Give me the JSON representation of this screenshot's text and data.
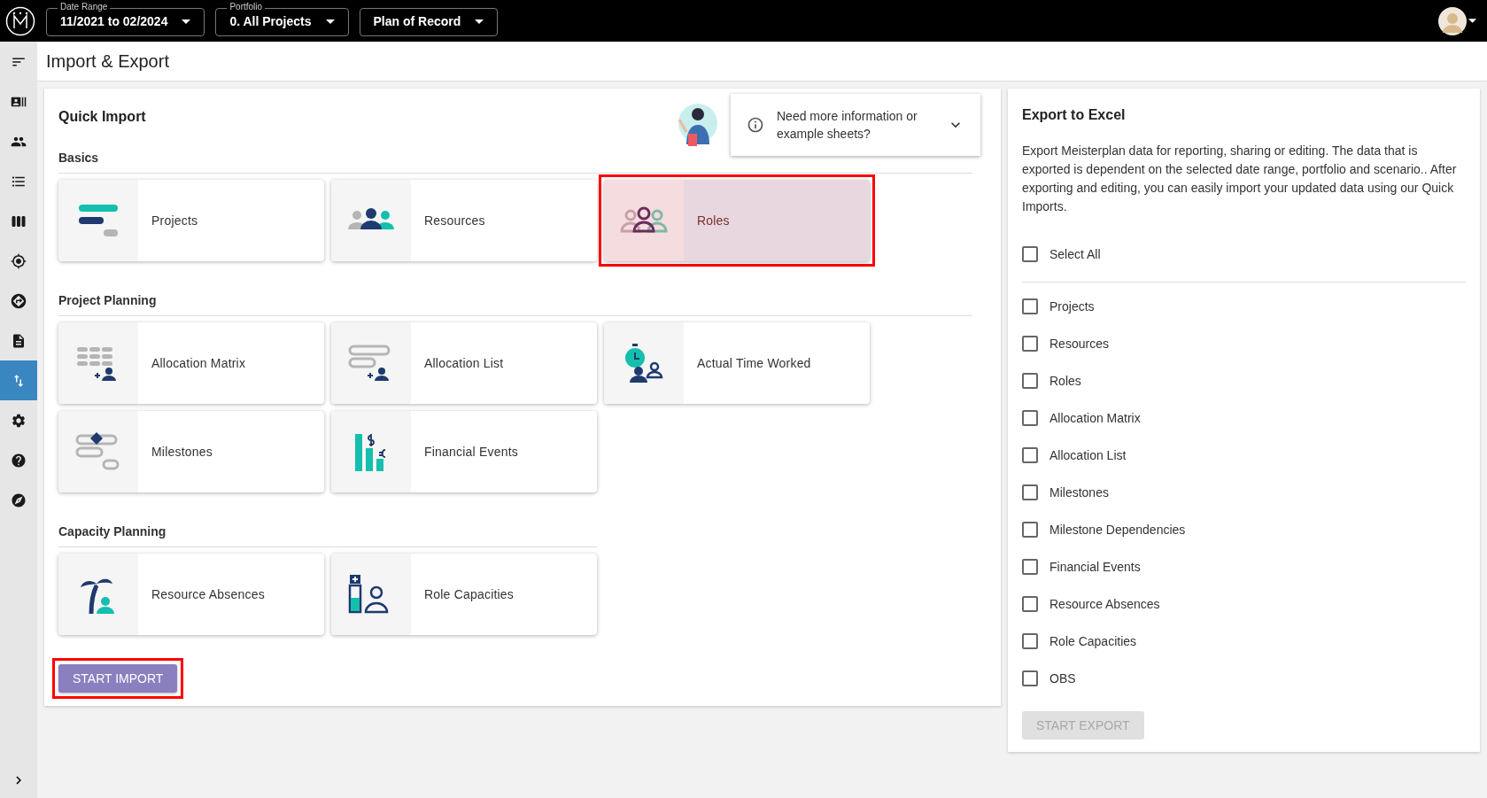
{
  "topbar": {
    "filters": [
      {
        "label": "Date Range",
        "value": "11/2021 to 02/2024"
      },
      {
        "label": "Portfolio",
        "value": "0. All Projects"
      },
      {
        "value": "Plan of Record"
      }
    ]
  },
  "sidebar": {
    "items": [
      {
        "kind": "menu",
        "selected": false
      },
      {
        "kind": "person-list",
        "selected": false
      },
      {
        "kind": "people",
        "selected": false
      },
      {
        "kind": "list",
        "selected": false
      },
      {
        "kind": "columns",
        "selected": false
      },
      {
        "kind": "target",
        "selected": false
      },
      {
        "kind": "direction",
        "selected": false
      },
      {
        "kind": "document",
        "selected": false
      },
      {
        "kind": "import-export",
        "selected": true
      },
      {
        "kind": "settings",
        "selected": false
      },
      {
        "kind": "help",
        "selected": false
      },
      {
        "kind": "compass",
        "selected": false
      }
    ]
  },
  "page_title": "Import & Export",
  "quick_import": {
    "title": "Quick Import",
    "help_text": "Need more information or example sheets?",
    "sections": [
      {
        "title": "Basics",
        "tiles": [
          {
            "kind": "projects",
            "label": "Projects",
            "selected": false,
            "highlighted": false
          },
          {
            "kind": "resources",
            "label": "Resources",
            "selected": false,
            "highlighted": false
          },
          {
            "kind": "roles",
            "label": "Roles",
            "selected": true,
            "highlighted": true
          }
        ]
      },
      {
        "title": "Project Planning",
        "tiles": [
          {
            "kind": "allocation-matrix",
            "label": "Allocation Matrix",
            "selected": false,
            "highlighted": false
          },
          {
            "kind": "allocation-list",
            "label": "Allocation List",
            "selected": false,
            "highlighted": false
          },
          {
            "kind": "time-worked",
            "label": "Actual Time Worked",
            "selected": false,
            "highlighted": false
          },
          {
            "kind": "milestones",
            "label": "Milestones",
            "selected": false,
            "highlighted": false
          },
          {
            "kind": "financial",
            "label": "Financial Events",
            "selected": false,
            "highlighted": false
          }
        ]
      },
      {
        "title": "Capacity Planning",
        "tiles": [
          {
            "kind": "absences",
            "label": "Resource Absences",
            "selected": false,
            "highlighted": false
          },
          {
            "kind": "capacities",
            "label": "Role Capacities",
            "selected": false,
            "highlighted": false
          }
        ]
      }
    ],
    "start_button": {
      "label": "START IMPORT",
      "highlighted": true
    }
  },
  "export": {
    "title": "Export to Excel",
    "description": "Export Meisterplan data for reporting, sharing or editing. The data that is exported is dependent on the selected date range, portfolio and scenario.. After exporting and editing, you can easily import your updated data using our Quick Imports.",
    "select_all": {
      "label": "Select All",
      "checked": false
    },
    "options": [
      {
        "label": "Projects",
        "checked": false
      },
      {
        "label": "Resources",
        "checked": false
      },
      {
        "label": "Roles",
        "checked": false
      },
      {
        "label": "Allocation Matrix",
        "checked": false
      },
      {
        "label": "Allocation List",
        "checked": false
      },
      {
        "label": "Milestones",
        "checked": false
      },
      {
        "label": "Milestone Dependencies",
        "checked": false
      },
      {
        "label": "Financial Events",
        "checked": false
      },
      {
        "label": "Resource Absences",
        "checked": false
      },
      {
        "label": "Role Capacities",
        "checked": false
      },
      {
        "label": "OBS",
        "checked": false
      }
    ],
    "button": {
      "label": "START EXPORT",
      "disabled": true
    }
  }
}
